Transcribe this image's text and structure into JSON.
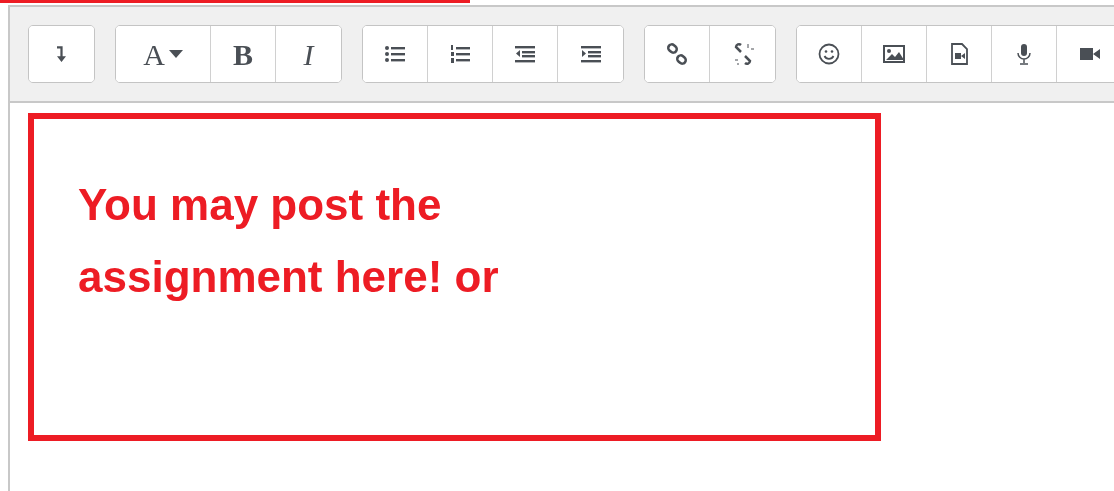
{
  "toolbar": {
    "groups": [
      {
        "buttons": [
          {
            "kind": "collapse"
          }
        ]
      },
      {
        "buttons": [
          {
            "kind": "fontcolor",
            "label": "A"
          },
          {
            "kind": "bold",
            "label": "B"
          },
          {
            "kind": "italic",
            "label": "I"
          }
        ]
      },
      {
        "buttons": [
          {
            "kind": "bullets"
          },
          {
            "kind": "numbers"
          },
          {
            "kind": "outdent"
          },
          {
            "kind": "indent"
          }
        ]
      },
      {
        "buttons": [
          {
            "kind": "link"
          },
          {
            "kind": "unlink"
          }
        ]
      },
      {
        "buttons": [
          {
            "kind": "emoji"
          },
          {
            "kind": "image"
          },
          {
            "kind": "media"
          },
          {
            "kind": "audio"
          },
          {
            "kind": "video"
          }
        ]
      }
    ]
  },
  "content": {
    "text": "You may post the assignment here! or"
  }
}
